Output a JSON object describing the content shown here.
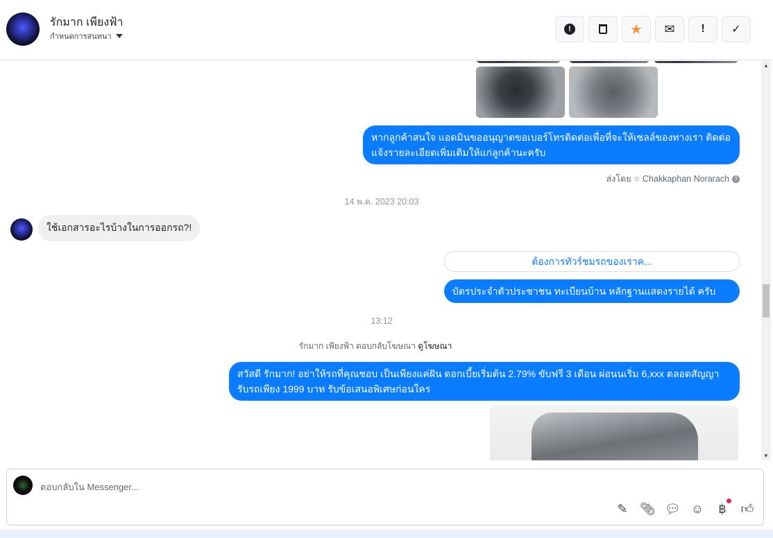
{
  "header": {
    "name": "รักมาก เพียงฟ้า",
    "subtitle": "กำหนดการสนทนา"
  },
  "actions": [
    {
      "name": "report-icon",
      "glyph": "⬤!"
    },
    {
      "name": "trash-icon",
      "glyph": "🗑"
    },
    {
      "name": "star-icon",
      "glyph": "★"
    },
    {
      "name": "mail-icon",
      "glyph": "✉"
    },
    {
      "name": "important-icon",
      "glyph": "!"
    },
    {
      "name": "check-icon",
      "glyph": "✓"
    }
  ],
  "messages": {
    "admin_text_1": "หากลูกค้าสนใจ แอดมินขออนุญาตขอเบอร์โทรติดต่อเพื่อที่จะให้เซลล์ของทางเรา ติดต่อแจ้งรายละเอียดเพิ่มเติมให้แก่ลูกค้านะครับ",
    "sent_by_label": "ส่งโดย",
    "sent_by_name": "Chakkaphan Norarach",
    "timestamp_1": "14 พ.ค. 2023 20:03",
    "customer_question": "ใช้เอกสารอะไรบ้างในการออกรถ?!",
    "quick_reply_link": "ต้องการทัวร์ชมรถของเราค...",
    "admin_text_2": "บัตรประจำตัวประชาชน ทะเบียนบ้าน หลักฐานแสดงรายได้ ครับ",
    "timestamp_2": "13:12",
    "ad_reply_text": "รักมาก เพียงฟ้า ตอบกลับโฆษณา",
    "ad_link": "ดูโฆษณา",
    "ad_message": "สวัสดี รักมาก! อย่าให้รถที่คุณชอบ เป็นเพียงแค่ฝัน ดอกเบี้ยเริ่มต้น 2.79% ขับฟรี 3 เดือน ผ่อนนเริ่ม 6,xxx ตลอดสัญญา รับรถเพียง 1999 บาท รับข้อเสนอพิเศษก่อนใคร"
  },
  "composer": {
    "placeholder": "ตอบกลับใน Messenger...",
    "colors": {
      "accent": "#0a7cff",
      "star": "#f5923e",
      "badge": "#f02849"
    }
  }
}
